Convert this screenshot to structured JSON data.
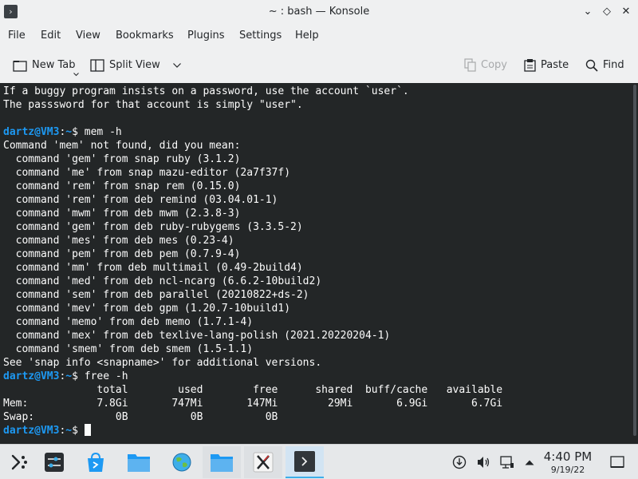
{
  "window": {
    "title": "~ : bash — Konsole",
    "minimize_glyph": "⌄",
    "maximize_glyph": "◇",
    "close_glyph": "✕"
  },
  "menu": [
    "File",
    "Edit",
    "View",
    "Bookmarks",
    "Plugins",
    "Settings",
    "Help"
  ],
  "toolbar": {
    "new_tab": "New Tab",
    "split_view": "Split View",
    "copy": "Copy",
    "paste": "Paste",
    "find": "Find"
  },
  "terminal": {
    "lines": [
      {
        "text": "If a buggy program insists on a password, use the account `user`."
      },
      {
        "text": "The passsword for that account is simply \"user\"."
      },
      {
        "text": ""
      },
      {
        "user": "dartz@VM3",
        "sep": ":",
        "path": "~",
        "cmd": "$ mem -h"
      },
      {
        "text": "Command 'mem' not found, did you mean:"
      },
      {
        "text": "  command 'gem' from snap ruby (3.1.2)"
      },
      {
        "text": "  command 'me' from snap mazu-editor (2a7f37f)"
      },
      {
        "text": "  command 'rem' from snap rem (0.15.0)"
      },
      {
        "text": "  command 'rem' from deb remind (03.04.01-1)"
      },
      {
        "text": "  command 'mwm' from deb mwm (2.3.8-3)"
      },
      {
        "text": "  command 'gem' from deb ruby-rubygems (3.3.5-2)"
      },
      {
        "text": "  command 'mes' from deb mes (0.23-4)"
      },
      {
        "text": "  command 'pem' from deb pem (0.7.9-4)"
      },
      {
        "text": "  command 'mm' from deb multimail (0.49-2build4)"
      },
      {
        "text": "  command 'med' from deb ncl-ncarg (6.6.2-10build2)"
      },
      {
        "text": "  command 'sem' from deb parallel (20210822+ds-2)"
      },
      {
        "text": "  command 'mev' from deb gpm (1.20.7-10build1)"
      },
      {
        "text": "  command 'memo' from deb memo (1.7.1-4)"
      },
      {
        "text": "  command 'mex' from deb texlive-lang-polish (2021.20220204-1)"
      },
      {
        "text": "  command 'smem' from deb smem (1.5-1.1)"
      },
      {
        "text": "See 'snap info <snapname>' for additional versions."
      },
      {
        "user": "dartz@VM3",
        "sep": ":",
        "path": "~",
        "cmd": "$ free -h"
      },
      {
        "text": "               total        used        free      shared  buff/cache   available"
      },
      {
        "text": "Mem:           7.8Gi       747Mi       147Mi        29Mi       6.9Gi       6.7Gi"
      },
      {
        "text": "Swap:             0B          0B          0B"
      },
      {
        "user": "dartz@VM3",
        "sep": ":",
        "path": "~",
        "cmd": "$ ",
        "cursor": true
      }
    ]
  },
  "taskbar": {
    "launcher_icon": "application-launcher-icon",
    "tasks": [
      {
        "name": "system-settings-icon"
      },
      {
        "name": "discover-store-icon"
      },
      {
        "name": "file-manager-icon"
      },
      {
        "name": "web-browser-icon"
      },
      {
        "name": "file-manager-window-icon",
        "state": "open"
      },
      {
        "name": "x-window-icon",
        "state": "open"
      },
      {
        "name": "konsole-icon",
        "state": "active"
      }
    ],
    "clock_time": "4:40 PM",
    "clock_date": "9/19/22"
  }
}
